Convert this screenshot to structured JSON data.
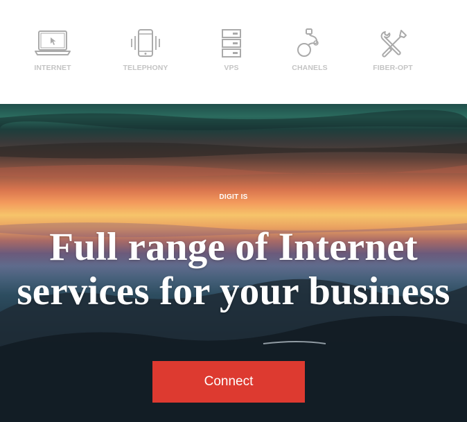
{
  "services": {
    "items": [
      {
        "label": "INTERNET",
        "icon": "laptop-icon"
      },
      {
        "label": "TELEPHONY",
        "icon": "smartphone-vibrate-icon"
      },
      {
        "label": "VPS",
        "icon": "server-rack-icon"
      },
      {
        "label": "CHANELS",
        "icon": "cable-plug-icon"
      },
      {
        "label": "FIBER-OPT",
        "icon": "wrench-screwdriver-icon"
      }
    ],
    "icon_color": "#aaaaaa",
    "label_color": "#c4c4c4"
  },
  "hero": {
    "eyebrow": "DIGIT IS",
    "title_line1": "Full range of Internet",
    "title_line2": "services for your business",
    "cta_label": "Connect",
    "cta_color": "#dd3a30"
  }
}
